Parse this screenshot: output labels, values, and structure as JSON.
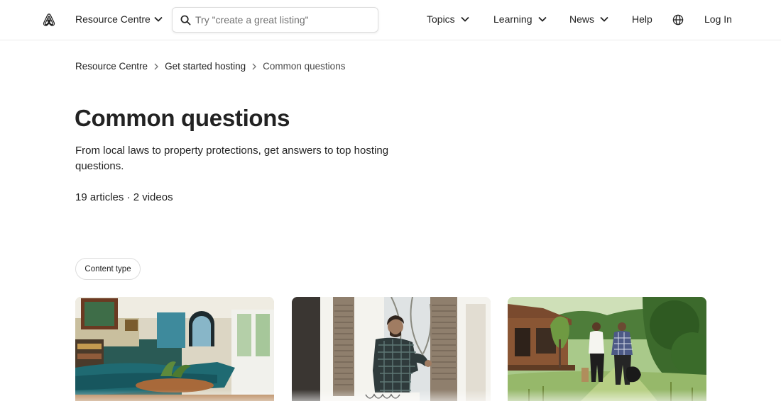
{
  "header": {
    "resource_centre_label": "Resource Centre",
    "search": {
      "placeholder": "Try \"create a great listing\""
    },
    "nav": {
      "topics": "Topics",
      "learning": "Learning",
      "news": "News",
      "help": "Help",
      "login": "Log In"
    },
    "icons": [
      "airbnb-logo",
      "chevron-down-icon",
      "search-icon",
      "globe-icon"
    ]
  },
  "breadcrumb": {
    "items": [
      "Resource Centre",
      "Get started hosting"
    ],
    "current": "Common questions"
  },
  "main": {
    "title": "Common questions",
    "description": "From local laws to property protections, get answers to top hosting questions.",
    "counts": "19 articles · 2 videos",
    "filter_label": "Content type"
  },
  "cards": [
    {
      "image": "living room with teal sofa"
    },
    {
      "image": "man opening wooden shutters"
    },
    {
      "image": "two people walking toward cabin"
    }
  ],
  "colors": {
    "text": "#222222",
    "muted": "#717171",
    "border": "#dddddd",
    "brand": "#222222"
  }
}
